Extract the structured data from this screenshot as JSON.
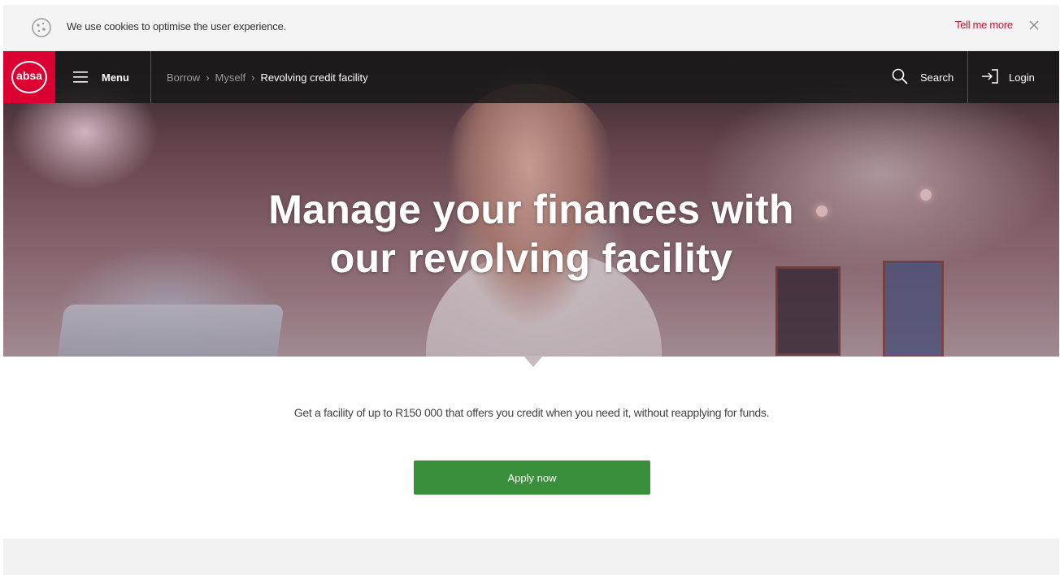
{
  "cookie_bar": {
    "message": "We use cookies to optimise the user experience.",
    "more_link": "Tell me more",
    "icon": "cookie-icon",
    "close_icon": "close-icon"
  },
  "nav": {
    "logo_text": "absa",
    "menu_label": "Menu",
    "breadcrumb": [
      "Borrow",
      "Myself",
      "Revolving credit facility"
    ],
    "search_label": "Search",
    "login_label": "Login"
  },
  "hero": {
    "title_line1": "Manage your finances with",
    "title_line2": "our revolving facility"
  },
  "content": {
    "intro": "Get a facility of up to R150 000 that offers you credit when you need it, without reapplying for funds.",
    "apply_button": "Apply now"
  },
  "colors": {
    "brand_red": "#dc0032",
    "link_red": "#c0182b",
    "apply_green": "#3a8f3a",
    "nav_dark": "#191919"
  }
}
